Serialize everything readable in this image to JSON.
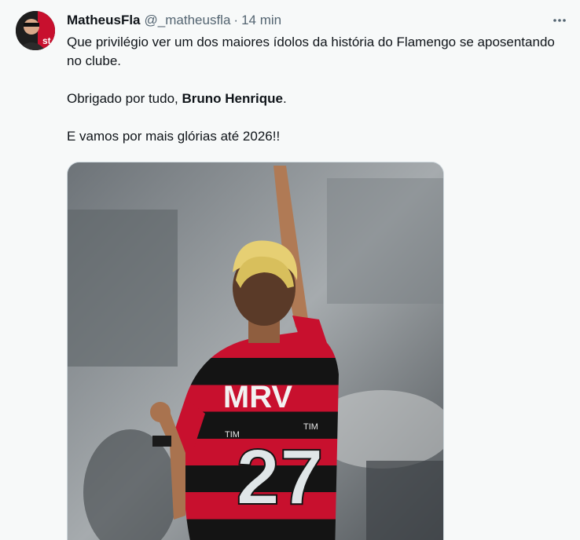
{
  "tweet": {
    "author_name": "MatheusFla",
    "author_handle": "@_matheusfla",
    "separator": "·",
    "timestamp": "14 min",
    "text_line1": "Que privilégio ver um dos maiores ídolos da história do Flamengo se aposentando no clube.",
    "text_line2_prefix": "Obrigado por tudo, ",
    "text_line2_bold": "Bruno Henrique",
    "text_line2_suffix": ".",
    "text_line3": "E vamos por mais glórias até 2026!!",
    "jersey_sponsor": "MRV",
    "jersey_number": "27",
    "jersey_sleeve_sponsor": "TIM"
  },
  "icons": {
    "more": "more-horizontal-icon"
  },
  "colors": {
    "background": "#f7f9f9",
    "text_primary": "#0f1419",
    "text_secondary": "#536471",
    "flamengo_red": "#c8102e",
    "flamengo_black": "#111111"
  }
}
